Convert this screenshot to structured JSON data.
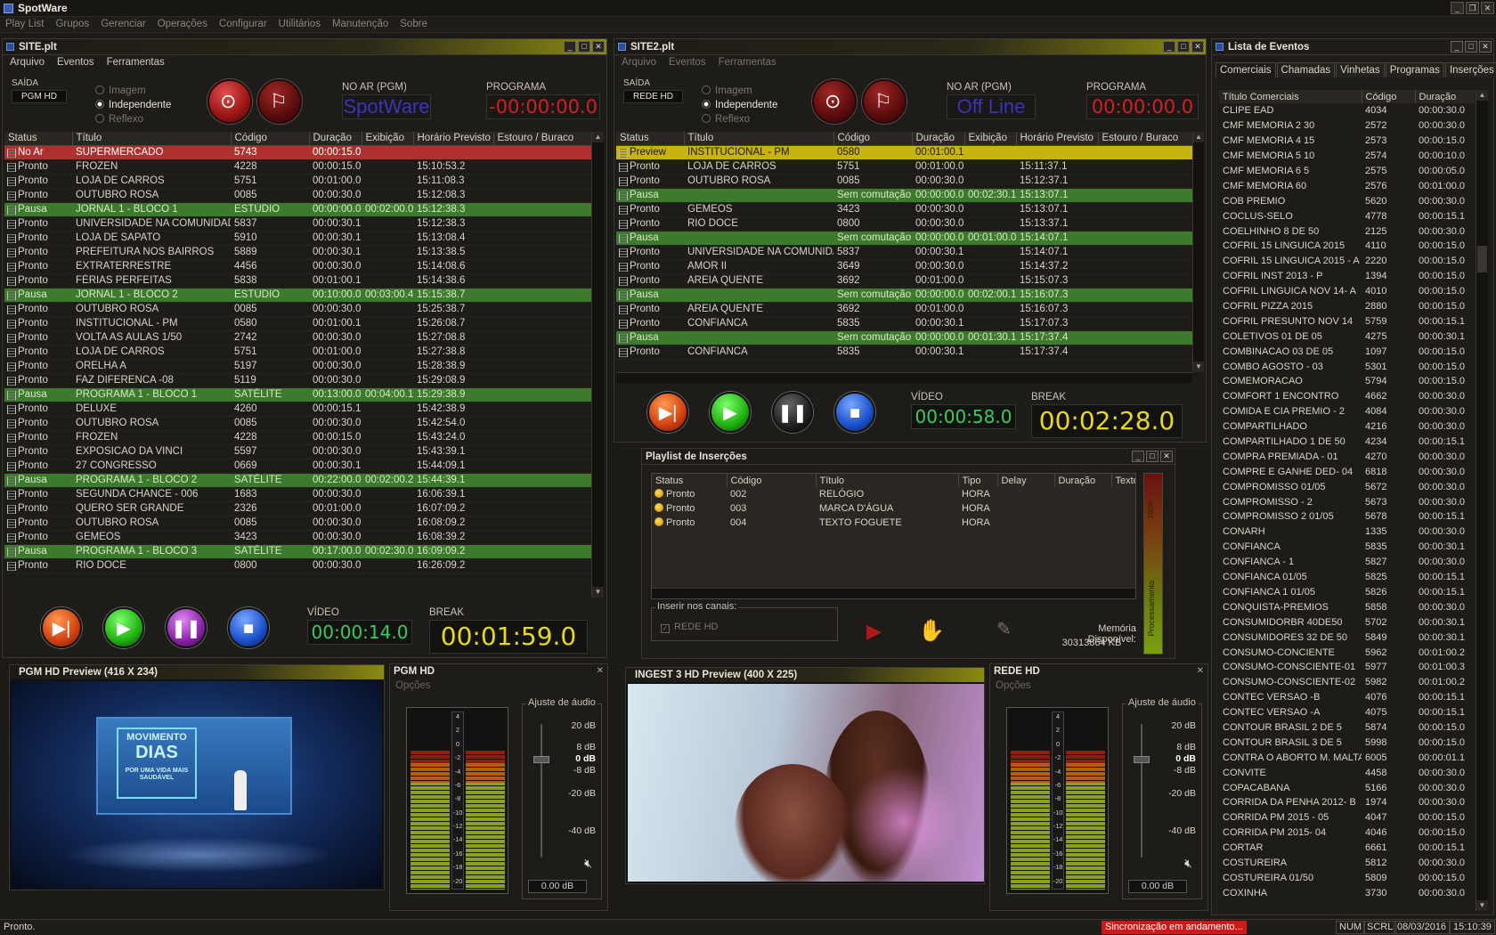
{
  "app": {
    "title": "SpotWare",
    "win_buttons": [
      "_",
      "❐",
      "✕"
    ]
  },
  "menu": [
    "Play List",
    "Grupos",
    "Gerenciar",
    "Operações",
    "Configurar",
    "Utilitários",
    "Manutenção",
    "Sobre"
  ],
  "site1": {
    "title": "SITE.plt",
    "menu": [
      "Arquivo",
      "Eventos",
      "Ferramentas"
    ],
    "saida_label": "SAÍDA",
    "saida_value": "PGM HD",
    "modes": [
      "Imagem",
      "Independente",
      "Reflexo"
    ],
    "noar_label": "NO AR (PGM)",
    "noar_value": "SpotWare",
    "programa_label": "PROGRAMA",
    "programa_value": "-00:00:00.0",
    "columns": [
      "Status",
      "Título",
      "Código",
      "Duração",
      "Exibição",
      "Horário Previsto",
      "Estouro / Buraco"
    ],
    "rows": [
      {
        "type": "noar",
        "c": [
          "No Ar",
          "SUPERMERCADO",
          "5743",
          "00:00:15.0",
          "",
          "",
          ""
        ]
      },
      {
        "type": "",
        "c": [
          "Pronto",
          "FROZEN",
          "4228",
          "00:00:15.0",
          "",
          "15:10:53.2",
          ""
        ]
      },
      {
        "type": "",
        "c": [
          "Pronto",
          "LOJA DE CARROS",
          "5751",
          "00:01:00.0",
          "",
          "15:11:08.3",
          ""
        ]
      },
      {
        "type": "",
        "c": [
          "Pronto",
          "OUTUBRO ROSA",
          "0085",
          "00:00:30.0",
          "",
          "15:12:08.3",
          ""
        ]
      },
      {
        "type": "pausa",
        "c": [
          "Pausa",
          "JORNAL 1 - BLOCO 1",
          "ESTÚDIO",
          "00:00:00.0",
          "00:02:00.0",
          "15:12:38.3",
          ""
        ]
      },
      {
        "type": "",
        "c": [
          "Pronto",
          "UNIVERSIDADE NA COMUNIDADE",
          "5837",
          "00:00:30.1",
          "",
          "15:12:38.3",
          ""
        ]
      },
      {
        "type": "",
        "c": [
          "Pronto",
          "LOJA DE SAPATO",
          "5910",
          "00:00:30.1",
          "",
          "15:13:08.4",
          ""
        ]
      },
      {
        "type": "",
        "c": [
          "Pronto",
          "PREFEITURA NOS BAIRROS",
          "5889",
          "00:00:30.1",
          "",
          "15:13:38.5",
          ""
        ]
      },
      {
        "type": "",
        "c": [
          "Pronto",
          "EXTRATERRESTRE",
          "4456",
          "00:00:30.0",
          "",
          "15:14:08.6",
          ""
        ]
      },
      {
        "type": "",
        "c": [
          "Pronto",
          "FÉRIAS PERFEITAS",
          "5838",
          "00:01:00.1",
          "",
          "15:14:38.6",
          ""
        ]
      },
      {
        "type": "pausa",
        "c": [
          "Pausa",
          "JORNAL 1 - BLOCO 2",
          "ESTÚDIO",
          "00:10:00.0",
          "00:03:00.4",
          "15:15:38.7",
          ""
        ]
      },
      {
        "type": "",
        "c": [
          "Pronto",
          "OUTUBRO ROSA",
          "0085",
          "00:00:30.0",
          "",
          "15:25:38.7",
          ""
        ]
      },
      {
        "type": "",
        "c": [
          "Pronto",
          "INSTITUCIONAL - PM",
          "0580",
          "00:01:00.1",
          "",
          "15:26:08.7",
          ""
        ]
      },
      {
        "type": "",
        "c": [
          "Pronto",
          "VOLTA  AS  AULAS  1/50",
          "2742",
          "00:00:30.0",
          "",
          "15:27:08.8",
          ""
        ]
      },
      {
        "type": "",
        "c": [
          "Pronto",
          "LOJA DE CARROS",
          "5751",
          "00:01:00.0",
          "",
          "15:27:38.8",
          ""
        ]
      },
      {
        "type": "",
        "c": [
          "Pronto",
          "ORELHA  A",
          "5197",
          "00:00:30.0",
          "",
          "15:28:38.9",
          ""
        ]
      },
      {
        "type": "",
        "c": [
          "Pronto",
          "FAZ  DIFERENCA  -08",
          "5119",
          "00:00:30.0",
          "",
          "15:29:08.9",
          ""
        ]
      },
      {
        "type": "pausa",
        "c": [
          "Pausa",
          "PROGRAMA 1 - BLOCO 1",
          "SATÉLITE",
          "00:13:00.0",
          "00:04:00.1",
          "15:29:38.9",
          ""
        ]
      },
      {
        "type": "",
        "c": [
          "Pronto",
          "DELUXE",
          "4260",
          "00:00:15.1",
          "",
          "15:42:38.9",
          ""
        ]
      },
      {
        "type": "",
        "c": [
          "Pronto",
          "OUTUBRO ROSA",
          "0085",
          "00:00:30.0",
          "",
          "15:42:54.0",
          ""
        ]
      },
      {
        "type": "",
        "c": [
          "Pronto",
          "FROZEN",
          "4228",
          "00:00:15.0",
          "",
          "15:43:24.0",
          ""
        ]
      },
      {
        "type": "",
        "c": [
          "Pronto",
          "EXPOSICAO  DA  VINCI",
          "5597",
          "00:00:30.0",
          "",
          "15:43:39.1",
          ""
        ]
      },
      {
        "type": "",
        "c": [
          "Pronto",
          "27  CONGRESSO",
          "0669",
          "00:00:30.1",
          "",
          "15:44:09.1",
          ""
        ]
      },
      {
        "type": "pausa",
        "c": [
          "Pausa",
          "PROGRAMA 1 - BLOCO 2",
          "SATÉLITE",
          "00:22:00.0",
          "00:02:00.2",
          "15:44:39.1",
          ""
        ]
      },
      {
        "type": "",
        "c": [
          "Pronto",
          "SEGUNDA  CHANCE  - 006",
          "1683",
          "00:00:30.0",
          "",
          "16:06:39.1",
          ""
        ]
      },
      {
        "type": "",
        "c": [
          "Pronto",
          "QUERO SER GRANDE",
          "2326",
          "00:01:00.0",
          "",
          "16:07:09.2",
          ""
        ]
      },
      {
        "type": "",
        "c": [
          "Pronto",
          "OUTUBRO ROSA",
          "0085",
          "00:00:30.0",
          "",
          "16:08:09.2",
          ""
        ]
      },
      {
        "type": "",
        "c": [
          "Pronto",
          "GEMEOS",
          "3423",
          "00:00:30.0",
          "",
          "16:08:39.2",
          ""
        ]
      },
      {
        "type": "pausa",
        "c": [
          "Pausa",
          "PROGRAMA 1 - BLOCO 3",
          "SATÉLITE",
          "00:17:00.0",
          "00:02:30.0",
          "16:09:09.2",
          ""
        ]
      },
      {
        "type": "",
        "c": [
          "Pronto",
          "RIO  DOCE",
          "0800",
          "00:00:30.0",
          "",
          "16:26:09.2",
          ""
        ]
      }
    ],
    "video_label": "VÍDEO",
    "video_value": "00:00:14.0",
    "break_label": "BREAK",
    "break_value": "00:01:59.0"
  },
  "site2": {
    "title": "SITE2.plt",
    "menu": [
      "Arquivo",
      "Eventos",
      "Ferramentas"
    ],
    "saida_label": "SAÍDA",
    "saida_value": "REDE HD",
    "modes": [
      "Imagem",
      "Independente",
      "Reflexo"
    ],
    "noar_label": "NO AR (PGM)",
    "noar_value": "Off Line",
    "programa_label": "PROGRAMA",
    "programa_value": "00:00:00.0",
    "columns": [
      "Status",
      "Título",
      "Código",
      "Duração",
      "Exibição",
      "Horário Previsto",
      "Estouro / Buraco"
    ],
    "rows": [
      {
        "type": "preview",
        "c": [
          "Preview",
          "INSTITUCIONAL - PM",
          "0580",
          "00:01:00.1",
          "",
          "",
          ""
        ]
      },
      {
        "type": "",
        "c": [
          "Pronto",
          "LOJA DE CARROS",
          "5751",
          "00:01:00.0",
          "",
          "15:11:37.1",
          ""
        ]
      },
      {
        "type": "",
        "c": [
          "Pronto",
          "OUTUBRO ROSA",
          "0085",
          "00:00:30.0",
          "",
          "15:12:37.1",
          ""
        ]
      },
      {
        "type": "pausa",
        "c": [
          "Pausa",
          "",
          "Sem comutação",
          "00:00:00.0",
          "00:02:30.1",
          "15:13:07.1",
          ""
        ]
      },
      {
        "type": "",
        "c": [
          "Pronto",
          "GEMEOS",
          "3423",
          "00:00:30.0",
          "",
          "15:13:07.1",
          ""
        ]
      },
      {
        "type": "",
        "c": [
          "Pronto",
          "RIO  DOCE",
          "0800",
          "00:00:30.0",
          "",
          "15:13:37.1",
          ""
        ]
      },
      {
        "type": "pausa",
        "c": [
          "Pausa",
          "",
          "Sem comutação",
          "00:00:00.0",
          "00:01:00.0",
          "15:14:07.1",
          ""
        ]
      },
      {
        "type": "",
        "c": [
          "Pronto",
          "UNIVERSIDADE NA COMUNIDADE",
          "5837",
          "00:00:30.1",
          "",
          "15:14:07.1",
          ""
        ]
      },
      {
        "type": "",
        "c": [
          "Pronto",
          "AMOR  II",
          "3649",
          "00:00:30.0",
          "",
          "15:14:37.2",
          ""
        ]
      },
      {
        "type": "",
        "c": [
          "Pronto",
          "AREIA  QUENTE",
          "3692",
          "00:01:00.0",
          "",
          "15:15:07.3",
          ""
        ]
      },
      {
        "type": "pausa",
        "c": [
          "Pausa",
          "",
          "Sem comutação",
          "00:00:00.0",
          "00:02:00.1",
          "15:16:07.3",
          ""
        ]
      },
      {
        "type": "",
        "c": [
          "Pronto",
          "AREIA  QUENTE",
          "3692",
          "00:01:00.0",
          "",
          "15:16:07.3",
          ""
        ]
      },
      {
        "type": "",
        "c": [
          "Pronto",
          "CONFIANCA",
          "5835",
          "00:00:30.1",
          "",
          "15:17:07.3",
          ""
        ]
      },
      {
        "type": "pausa",
        "c": [
          "Pausa",
          "",
          "Sem comutação",
          "00:00:00.0",
          "00:01:30.1",
          "15:17:37.4",
          ""
        ]
      },
      {
        "type": "",
        "c": [
          "Pronto",
          "CONFIANCA",
          "5835",
          "00:00:30.1",
          "",
          "15:17:37.4",
          ""
        ]
      }
    ],
    "video_label": "VÍDEO",
    "video_value": "00:00:58.0",
    "break_label": "BREAK",
    "break_value": "00:02:28.0"
  },
  "insercoes": {
    "title": "Playlist de Inserções",
    "columns": [
      "Status",
      "Código",
      "Título",
      "Tipo",
      "Delay",
      "Duração",
      "Texto"
    ],
    "rows": [
      [
        "Pronto",
        "002",
        "RELÓGIO",
        "HORA",
        "",
        "",
        ""
      ],
      [
        "Pronto",
        "003",
        "MARCA D'ÁGUA",
        "HORA",
        "",
        "",
        ""
      ],
      [
        "Pronto",
        "004",
        "TEXTO FOGUETE",
        "HORA",
        "",
        "",
        ""
      ]
    ],
    "canais_label": "Inserir nos canais:",
    "canal": "REDE HD",
    "memoria_label": "Memória Disponível:",
    "memoria_value": "30313864 KB",
    "meter_labels": [
      "100%",
      "Processamento"
    ]
  },
  "preview1": {
    "title": "PGM HD  Preview  (416 X 234)",
    "tv_line1": "MOVIMENTO",
    "tv_line2": "DIAS",
    "tv_line3": "POR UMA VIDA MAIS SAUDÁVEL"
  },
  "preview2": {
    "title": "INGEST 3 HD  Preview  (400 X 225)"
  },
  "meter1": {
    "title": "PGM HD",
    "opcoes": "Opções",
    "close": "✕",
    "audio_label": "Ajuste de áudio",
    "db_marks": [
      "20 dB",
      "8 dB",
      "0 dB",
      "-8 dB",
      "-20 dB",
      "-40 dB"
    ],
    "value": "0.00 dB",
    "scale": [
      "4",
      "2",
      "0",
      "-2",
      "-4",
      "-6",
      "-8",
      "-10",
      "-12",
      "-14",
      "-16",
      "-18",
      "-20"
    ],
    "levels": [
      0.78,
      0.78
    ]
  },
  "meter2": {
    "title": "REDE HD",
    "opcoes": "Opções",
    "close": "✕",
    "audio_label": "Ajuste de áudio",
    "db_marks": [
      "20 dB",
      "8 dB",
      "0 dB",
      "-8 dB",
      "-20 dB",
      "-40 dB"
    ],
    "value": "0.00 dB",
    "scale": [
      "4",
      "2",
      "0",
      "-2",
      "-4",
      "-6",
      "-8",
      "-10",
      "-12",
      "-14",
      "-16",
      "-18",
      "-20"
    ],
    "levels": [
      0.78,
      0.78
    ]
  },
  "eventos": {
    "title": "Lista de Eventos",
    "tabs": [
      "Comerciais",
      "Chamadas",
      "Vinhetas",
      "Programas",
      "Inserções"
    ],
    "columns": [
      "Título Comerciais",
      "Código",
      "Duração"
    ],
    "rows": [
      [
        "CLIPE EAD",
        "4034",
        "00:00:30.0"
      ],
      [
        "CMF MEMORIA 2 30",
        "2572",
        "00:00:30.0"
      ],
      [
        "CMF MEMORIA 4 15",
        "2573",
        "00:00:15.0"
      ],
      [
        "CMF MEMORIA 5 10",
        "2574",
        "00:00:10.0"
      ],
      [
        "CMF MEMORIA 6 5",
        "2575",
        "00:00:05.0"
      ],
      [
        "CMF MEMORIA 60",
        "2576",
        "00:01:00.0"
      ],
      [
        "COB PREMIO",
        "5620",
        "00:00:30.0"
      ],
      [
        "COCLUS-SELO",
        "4778",
        "00:00:15.1"
      ],
      [
        "COELHINHO  8 DE 50",
        "2125",
        "00:00:30.0"
      ],
      [
        "COFRIL  15 LINGUICA  2015",
        "4110",
        "00:00:15.0"
      ],
      [
        "COFRIL  15 LINGUICA  2015 - A",
        "2220",
        "00:00:15.0"
      ],
      [
        "COFRIL  INST  2013 - P",
        "1394",
        "00:00:15.0"
      ],
      [
        "COFRIL  LINGUICA  NOV  14-  A",
        "4010",
        "00:00:15.0"
      ],
      [
        "COFRIL  PIZZA  2015",
        "2880",
        "00:00:15.0"
      ],
      [
        "COFRIL PRESUNTO NOV 14",
        "5759",
        "00:00:15.1"
      ],
      [
        "COLETIVOS  01 DE 05",
        "4275",
        "00:00:30.1"
      ],
      [
        "COMBINACAO  03 DE 05",
        "1097",
        "00:00:15.0"
      ],
      [
        "COMBO  AGOSTO - 03",
        "5301",
        "00:00:15.0"
      ],
      [
        "COMEMORACAO",
        "5794",
        "00:00:15.0"
      ],
      [
        "COMFORT 1 ENCONTRO",
        "4662",
        "00:00:30.0"
      ],
      [
        "COMIDA  E  CIA PREMIO -  2",
        "4084",
        "00:00:30.0"
      ],
      [
        "COMPARTILHADO",
        "4216",
        "00:00:30.0"
      ],
      [
        "COMPARTILHADO  1 DE 50",
        "4234",
        "00:00:15.1"
      ],
      [
        "COMPRA  PREMIADA - 01",
        "4270",
        "00:00:30.0"
      ],
      [
        "COMPRE  E  GANHE  DED- 04",
        "6818",
        "00:00:30.0"
      ],
      [
        "COMPROMISSO  01/05",
        "5672",
        "00:00:30.0"
      ],
      [
        "COMPROMISSO  - 2",
        "5673",
        "00:00:30.0"
      ],
      [
        "COMPROMISSO  2  01/05",
        "5678",
        "00:00:15.1"
      ],
      [
        "CONARH",
        "1335",
        "00:00:30.0"
      ],
      [
        "CONFIANCA",
        "5835",
        "00:00:30.1"
      ],
      [
        "CONFIANCA  - 1",
        "5827",
        "00:00:30.0"
      ],
      [
        "CONFIANCA  01/05",
        "5825",
        "00:00:15.1"
      ],
      [
        "CONFIANCA  1  01/05",
        "5826",
        "00:00:15.1"
      ],
      [
        "CONQUISTA-PREMIOS",
        "5858",
        "00:00:30.0"
      ],
      [
        "CONSUMIDORBR  40DE50",
        "5702",
        "00:00:30.1"
      ],
      [
        "CONSUMIDORES  32 DE 50",
        "5849",
        "00:00:30.1"
      ],
      [
        "CONSUMO-CONCIENTE",
        "5962",
        "00:01:00.2"
      ],
      [
        "CONSUMO-CONSCIENTE-01",
        "5977",
        "00:01:00.3"
      ],
      [
        "CONSUMO-CONSCIENTE-02",
        "5982",
        "00:01:00.2"
      ],
      [
        "CONTEC  VERSAO  -B",
        "4076",
        "00:00:15.1"
      ],
      [
        "CONTEC  VERSAO  -A",
        "4075",
        "00:00:15.1"
      ],
      [
        "CONTOUR  BRASIL  2 DE 5",
        "5874",
        "00:00:15.0"
      ],
      [
        "CONTOUR  BRASIL  3 DE 5",
        "5998",
        "00:00:15.0"
      ],
      [
        "CONTRA O ABORTO  M. MALTA",
        "6005",
        "00:00:01.1"
      ],
      [
        "CONVITE",
        "4458",
        "00:00:30.0"
      ],
      [
        "COPACABANA",
        "5166",
        "00:00:30.0"
      ],
      [
        "CORRIDA  DA  PENHA  2012-  B",
        "1974",
        "00:00:30.0"
      ],
      [
        "CORRIDA  PM  2015  - 05",
        "4047",
        "00:00:15.0"
      ],
      [
        "CORRIDA PM  2015- 04",
        "4046",
        "00:00:15.0"
      ],
      [
        "CORTAR",
        "6661",
        "00:00:15.1"
      ],
      [
        "COSTUREIRA",
        "5812",
        "00:00:30.0"
      ],
      [
        "COSTUREIRA  01/50",
        "5809",
        "00:00:15.0"
      ],
      [
        "COXINHA",
        "3730",
        "00:00:30.0"
      ]
    ]
  },
  "status": {
    "message": "Pronto.",
    "sync": "Sincronização em andamento...",
    "num": "NUM",
    "scrl": "SCRL",
    "date": "08/03/2016",
    "time": "15:10:39"
  }
}
